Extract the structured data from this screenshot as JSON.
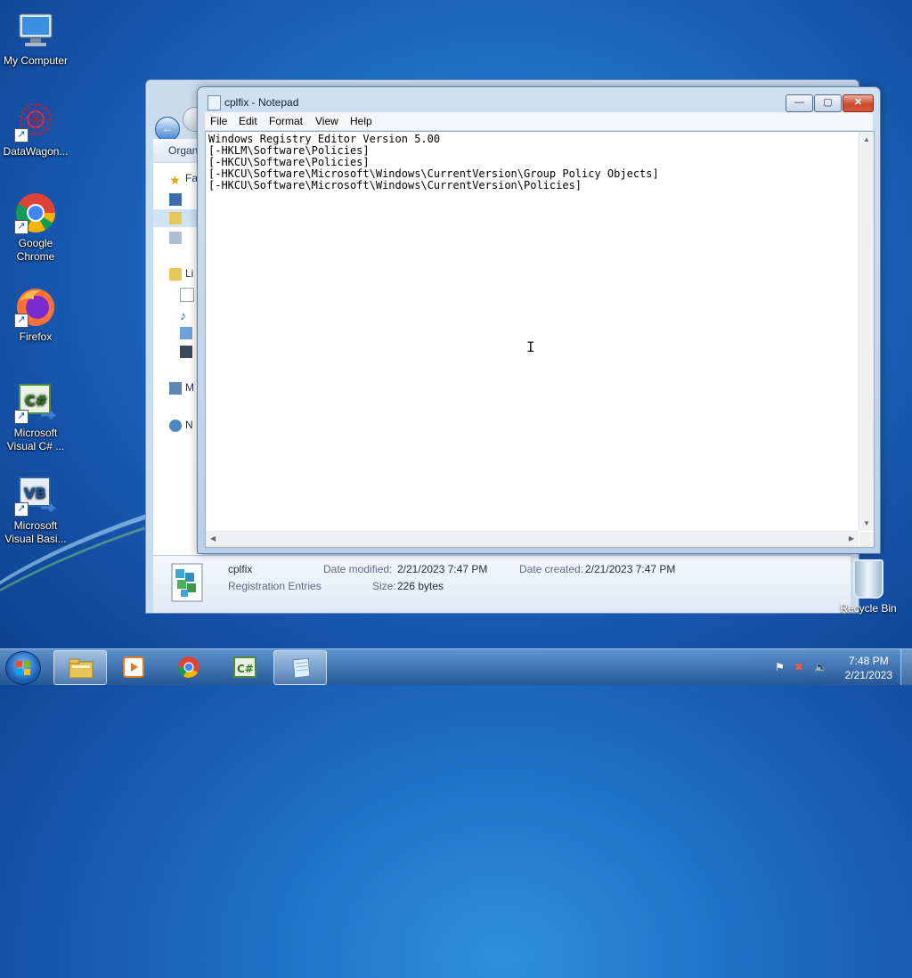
{
  "desktop": {
    "icons": [
      {
        "label": "My Computer",
        "icon": "computer-icon"
      },
      {
        "label": "DataWagon...",
        "icon": "datawagon-icon"
      },
      {
        "label": "Google Chrome",
        "icon": "chrome-icon"
      },
      {
        "label": "Firefox",
        "icon": "firefox-icon"
      },
      {
        "label": "Microsoft Visual C# ...",
        "icon": "visual-csharp-icon"
      },
      {
        "label": "Microsoft Visual Basi...",
        "icon": "visual-basic-icon"
      },
      {
        "label": "Recycle Bin",
        "icon": "recycle-bin-icon"
      }
    ]
  },
  "explorer": {
    "toolbar_organize": "Organ",
    "nav_items": [
      "Fa",
      "Li",
      "M",
      "N"
    ],
    "details": {
      "file_name": "cplfix",
      "file_type": "Registration Entries",
      "date_modified_label": "Date modified:",
      "date_modified": "2/21/2023 7:47 PM",
      "size_label": "Size:",
      "size": "226 bytes",
      "date_created_label": "Date created:",
      "date_created": "2/21/2023 7:47 PM"
    }
  },
  "notepad": {
    "title": "cplfix - Notepad",
    "menu": [
      "File",
      "Edit",
      "Format",
      "View",
      "Help"
    ],
    "lines": [
      "Windows Registry Editor Version 5.00",
      "[-HKLM\\Software\\Policies]",
      "[-HKCU\\Software\\Policies]",
      "[-HKCU\\Software\\Microsoft\\Windows\\CurrentVersion\\Group Policy Objects]",
      "[-HKCU\\Software\\Microsoft\\Windows\\CurrentVersion\\Policies]"
    ]
  },
  "taskbar": {
    "apps": [
      "explorer-icon",
      "media-player-icon",
      "chrome-icon",
      "visual-csharp-icon",
      "notepad-icon"
    ],
    "clock_time": "7:48 PM",
    "clock_date": "2/21/2023"
  },
  "colors": {
    "desktop_blue": "#1f6fc7",
    "close_red": "#c84b30"
  }
}
